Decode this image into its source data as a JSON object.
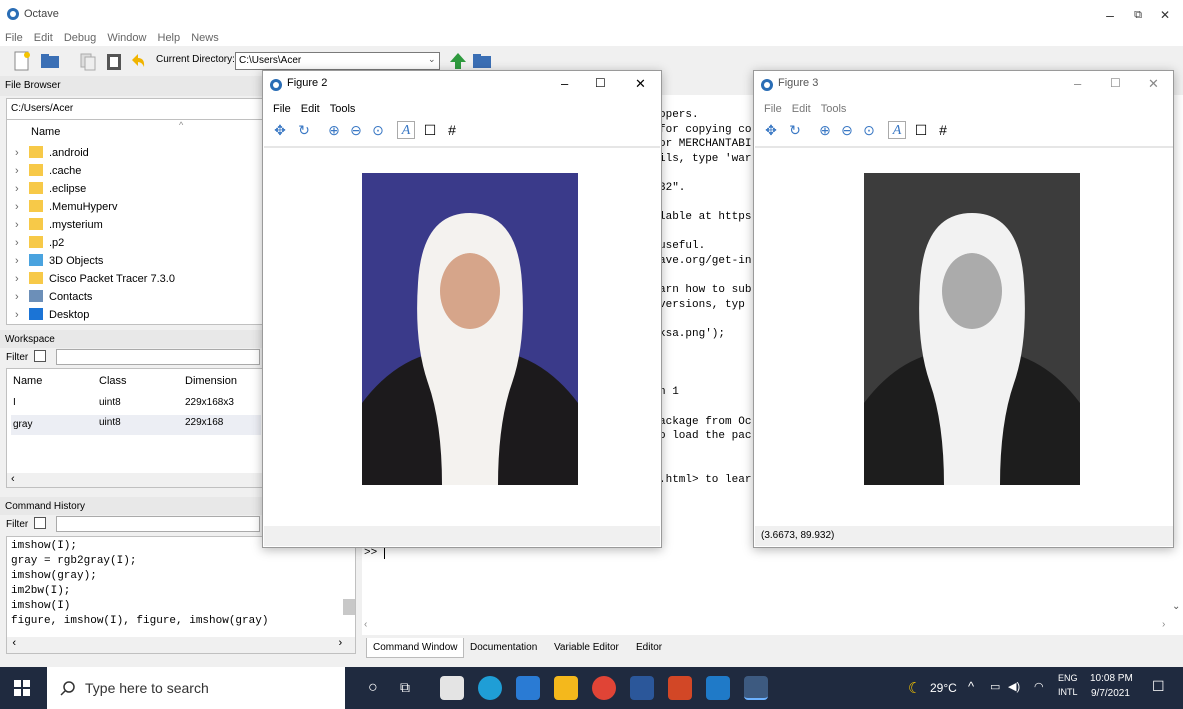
{
  "app": {
    "title": "Octave"
  },
  "window_controls": {
    "minimize": "–",
    "maximize": "⧉",
    "close": "✕"
  },
  "menu": [
    "File",
    "Edit",
    "Debug",
    "Window",
    "Help",
    "News"
  ],
  "toolbar": {
    "current_dir_label": "Current Directory:",
    "current_dir_value": "C:\\Users\\Acer"
  },
  "file_browser": {
    "title": "File Browser",
    "path": "C:/Users/Acer",
    "column": "Name",
    "items": [
      {
        "label": ".android",
        "icon": "folder-icon"
      },
      {
        "label": ".cache",
        "icon": "folder-icon"
      },
      {
        "label": ".eclipse",
        "icon": "folder-icon"
      },
      {
        "label": ".MemuHyperv",
        "icon": "folder-icon"
      },
      {
        "label": ".mysterium",
        "icon": "folder-icon"
      },
      {
        "label": ".p2",
        "icon": "folder-icon"
      },
      {
        "label": "3D Objects",
        "icon": "3d-objects-icon"
      },
      {
        "label": "Cisco Packet Tracer 7.3.0",
        "icon": "folder-icon"
      },
      {
        "label": "Contacts",
        "icon": "contacts-icon"
      },
      {
        "label": "Desktop",
        "icon": "desktop-icon"
      }
    ]
  },
  "workspace": {
    "title": "Workspace",
    "filter_label": "Filter",
    "columns": [
      "Name",
      "Class",
      "Dimension"
    ],
    "rows": [
      {
        "name": "I",
        "class": "uint8",
        "dimension": "229x168x3"
      },
      {
        "name": "gray",
        "class": "uint8",
        "dimension": "229x168"
      }
    ]
  },
  "command_history": {
    "title": "Command History",
    "filter_label": "Filter",
    "items": [
      "imshow(I);",
      "gray = rgb2gray(I);",
      "imshow(gray);",
      "im2bw(I);",
      "imshow(I)",
      "figure, imshow(I), figure, imshow(gray)"
    ]
  },
  "command_window": {
    "lines": [
      "opers.",
      "for copying co",
      "or MERCHANTABI",
      "ils, type 'war",
      "",
      "32\".",
      "",
      "lable at https",
      "",
      "useful.",
      "ave.org/get-in",
      "",
      "arn how to sub",
      "versions, typ",
      "",
      "ksa.png');",
      "",
      "",
      "",
      "n 1",
      "",
      "ackage from Oc",
      "o load the pac",
      "",
      "",
      ".html> to lear"
    ],
    "prompt": ">>"
  },
  "bottom_tabs": [
    "Command Window",
    "Documentation",
    "Variable Editor",
    "Editor"
  ],
  "figure2": {
    "title": "Figure 2",
    "menu": [
      "File",
      "Edit",
      "Tools"
    ]
  },
  "figure3": {
    "title": "Figure 3",
    "menu": [
      "File",
      "Edit",
      "Tools"
    ],
    "status": "(3.6673, 89.932)"
  },
  "taskbar": {
    "search_placeholder": "Type here to search",
    "weather": "29°C",
    "lang_top": "ENG",
    "lang_bottom": "INTL",
    "time": "10:08 PM",
    "date": "9/7/2021"
  },
  "colors": {
    "photo_background": "#3a3a8a",
    "grayscale_background": "#3c3c3c",
    "taskbar": "#1f2a3f"
  }
}
